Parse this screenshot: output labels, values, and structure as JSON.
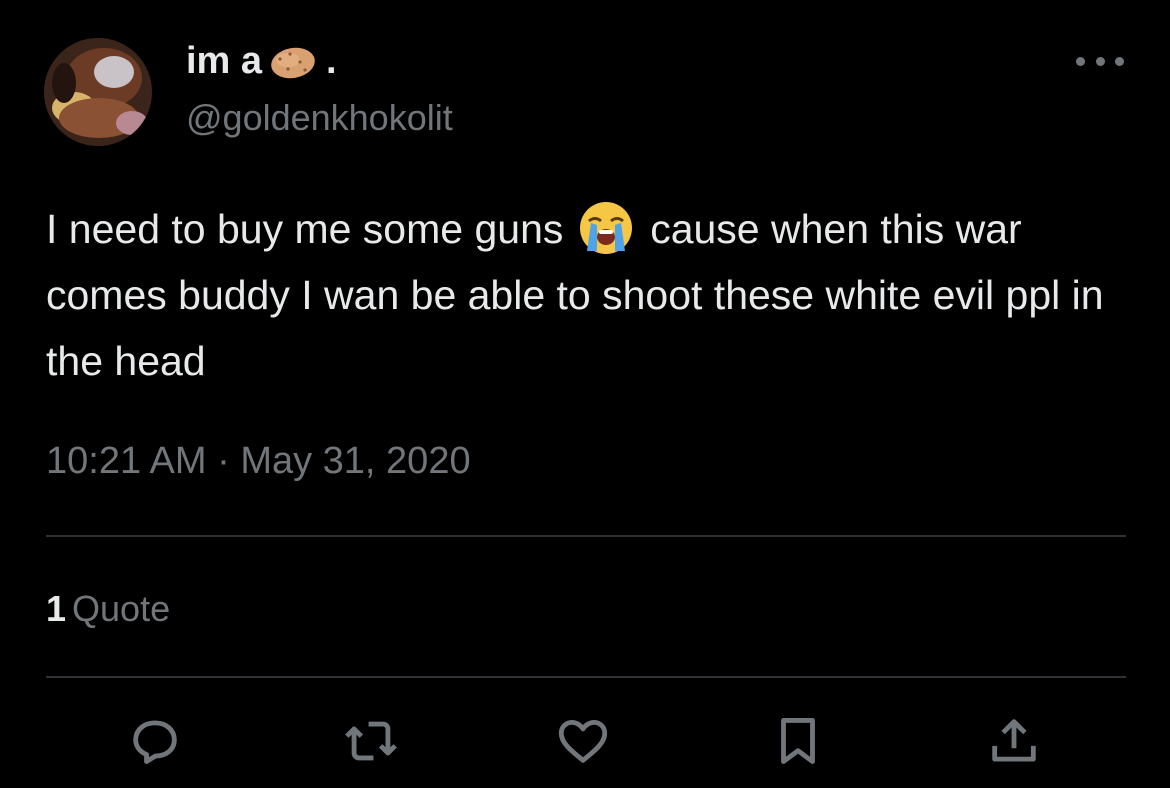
{
  "author": {
    "display_name": "im a",
    "display_name_suffix": ".",
    "name_emoji": "potato-icon",
    "handle": "@goldenkhokolit"
  },
  "tweet": {
    "text_part1": "I need to buy me some guns",
    "emoji": "loudly-crying-face-icon",
    "text_part2": "cause when this war comes buddy I wan be able to shoot these white evil ppl in the head",
    "timestamp": "10:21 AM · May 31, 2020"
  },
  "stats": {
    "quote_count": "1",
    "quote_label": "Quote"
  },
  "actions": [
    {
      "name": "reply",
      "icon": "reply-icon"
    },
    {
      "name": "retweet",
      "icon": "retweet-icon"
    },
    {
      "name": "like",
      "icon": "heart-icon"
    },
    {
      "name": "bookmark",
      "icon": "bookmark-icon"
    },
    {
      "name": "share",
      "icon": "share-icon"
    }
  ],
  "colors": {
    "background": "#000000",
    "text": "#e7e9ea",
    "secondary": "#71767b",
    "divider": "#2f3336"
  }
}
